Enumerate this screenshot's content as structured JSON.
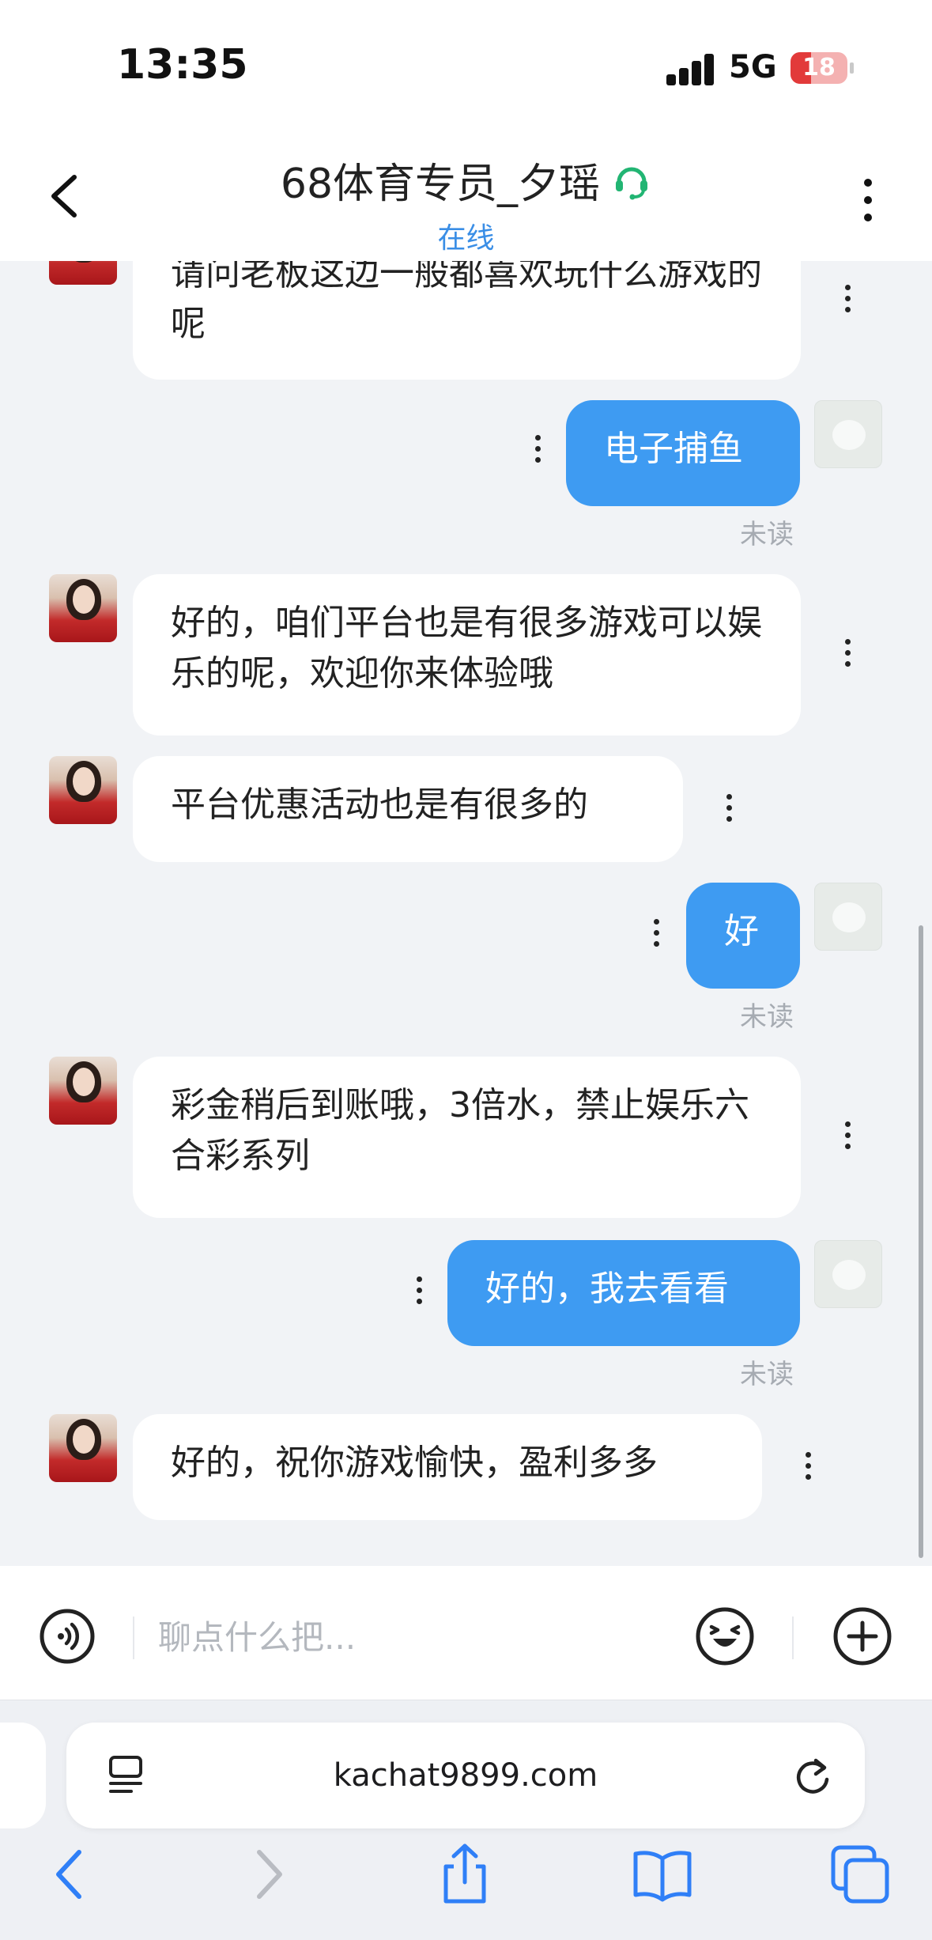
{
  "status_bar": {
    "time": "13:35",
    "network": "5G",
    "battery": "18",
    "battery_level": 0.18
  },
  "header": {
    "title": "68体育专员_夕瑶",
    "status": "在线"
  },
  "messages": [
    {
      "from": "agent",
      "text": "请问老板这边一般都喜欢玩什么游戏的呢"
    },
    {
      "from": "me",
      "text": "电子捕鱼",
      "status": "未读"
    },
    {
      "from": "agent",
      "text": "好的，咱们平台也是有很多游戏可以娱乐的呢，欢迎你来体验哦"
    },
    {
      "from": "agent",
      "text": "平台优惠活动也是有很多的"
    },
    {
      "from": "me",
      "text": "好",
      "status": "未读"
    },
    {
      "from": "agent",
      "text": "彩金稍后到账哦，3倍水，禁止娱乐六合彩系列"
    },
    {
      "from": "me",
      "text": "好的，我去看看",
      "status": "未读"
    },
    {
      "from": "agent",
      "text": "好的，祝你游戏愉快，盈利多多"
    }
  ],
  "input": {
    "placeholder": "聊点什么把..."
  },
  "browser": {
    "url": "kachat9899.com"
  },
  "colors": {
    "accent": "#3e9bf2",
    "online": "#3a8ee6",
    "headset": "#22b573"
  },
  "icons": [
    "back-icon",
    "headset-icon",
    "more-icon",
    "voice-icon",
    "emoji-icon",
    "plus-icon",
    "reader-icon",
    "reload-icon",
    "browser-back-icon",
    "browser-forward-icon",
    "share-icon",
    "bookmarks-icon",
    "tabs-icon"
  ]
}
